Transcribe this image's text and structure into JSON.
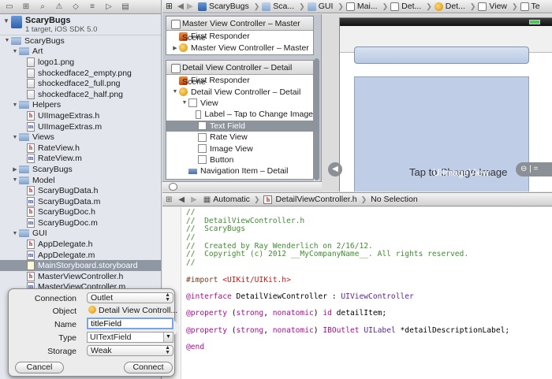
{
  "navigator": {
    "project": {
      "name": "ScaryBugs",
      "subtitle": "1 target, iOS SDK 5.0"
    },
    "tree": [
      {
        "label": "ScaryBugs",
        "kind": "folder",
        "level": 1,
        "open": true
      },
      {
        "label": "Art",
        "kind": "folder",
        "level": 2,
        "open": true
      },
      {
        "label": "logo1.png",
        "kind": "img",
        "level": 3
      },
      {
        "label": "shockedface2_empty.png",
        "kind": "img",
        "level": 3
      },
      {
        "label": "shockedface2_full.png",
        "kind": "img",
        "level": 3
      },
      {
        "label": "shockedface2_half.png",
        "kind": "img",
        "level": 3
      },
      {
        "label": "Helpers",
        "kind": "folder",
        "level": 2,
        "open": true
      },
      {
        "label": "UIImageExtras.h",
        "kind": "h",
        "level": 3
      },
      {
        "label": "UIImageExtras.m",
        "kind": "m",
        "level": 3
      },
      {
        "label": "Views",
        "kind": "folder",
        "level": 2,
        "open": true
      },
      {
        "label": "RateView.h",
        "kind": "h",
        "level": 3
      },
      {
        "label": "RateView.m",
        "kind": "m",
        "level": 3
      },
      {
        "label": "ScaryBugs",
        "kind": "folder",
        "level": 2,
        "open": false
      },
      {
        "label": "Model",
        "kind": "folder",
        "level": 2,
        "open": true
      },
      {
        "label": "ScaryBugData.h",
        "kind": "h",
        "level": 3
      },
      {
        "label": "ScaryBugData.m",
        "kind": "m",
        "level": 3
      },
      {
        "label": "ScaryBugDoc.h",
        "kind": "h",
        "level": 3
      },
      {
        "label": "ScaryBugDoc.m",
        "kind": "m",
        "level": 3
      },
      {
        "label": "GUI",
        "kind": "folder",
        "level": 2,
        "open": true
      },
      {
        "label": "AppDelegate.h",
        "kind": "h",
        "level": 3
      },
      {
        "label": "AppDelegate.m",
        "kind": "m",
        "level": 3
      },
      {
        "label": "MainStoryboard.storyboard",
        "kind": "sb",
        "level": 3,
        "selected": true
      },
      {
        "label": "MasterViewController.h",
        "kind": "h",
        "level": 3
      },
      {
        "label": "MasterViewController.m",
        "kind": "m",
        "level": 3
      }
    ]
  },
  "jumpbar": {
    "items": [
      {
        "label": "ScaryBugs",
        "icon": "proj"
      },
      {
        "label": "Sca...",
        "icon": "fold"
      },
      {
        "label": "GUI",
        "icon": "fold"
      },
      {
        "label": "Mai...",
        "icon": "file"
      },
      {
        "label": "Det...",
        "icon": "file"
      },
      {
        "label": "Det...",
        "icon": "obj"
      },
      {
        "label": "View",
        "icon": "file"
      },
      {
        "label": "Te",
        "icon": "file"
      }
    ]
  },
  "outline": {
    "master_scene": {
      "title": "Master View Controller – Master Scene",
      "rows": [
        {
          "label": "First Responder",
          "icon": "fr",
          "level": 1
        },
        {
          "label": "Master View Controller – Master",
          "icon": "vc",
          "level": 1,
          "disclosure": "closed"
        }
      ]
    },
    "detail_scene": {
      "title": "Detail View Controller – Detail Scene",
      "rows": [
        {
          "label": "First Responder",
          "icon": "fr",
          "level": 1
        },
        {
          "label": "Detail View Controller – Detail",
          "icon": "vc",
          "level": 1,
          "disclosure": "open"
        },
        {
          "label": "View",
          "icon": "view",
          "level": 2,
          "disclosure": "open"
        },
        {
          "label": "Label – Tap to Change Image",
          "icon": "view",
          "level": 3
        },
        {
          "label": "Text Field",
          "icon": "view",
          "level": 3,
          "selected": true
        },
        {
          "label": "Rate View",
          "icon": "view",
          "level": 3
        },
        {
          "label": "Image View",
          "icon": "view",
          "level": 3
        },
        {
          "label": "Button",
          "icon": "view",
          "level": 3
        },
        {
          "label": "Navigation Item – Detail",
          "icon": "nav-item",
          "level": 2
        }
      ]
    }
  },
  "canvas": {
    "label_text": "Tap to Change Image",
    "label_overlay": "UIImageView"
  },
  "editor_jump": {
    "scheme": "Automatic",
    "file": "DetailViewController.h",
    "selection": "No Selection"
  },
  "code": [
    {
      "text": "//",
      "class": "c-comment"
    },
    {
      "text": "//  DetailViewController.h",
      "class": "c-comment"
    },
    {
      "text": "//  ScaryBugs",
      "class": "c-comment"
    },
    {
      "text": "//",
      "class": "c-comment"
    },
    {
      "text": "//  Created by Ray Wenderlich on 2/16/12.",
      "class": "c-comment"
    },
    {
      "text": "//  Copyright (c) 2012 __MyCompanyName__. All rights reserved.",
      "class": "c-comment"
    },
    {
      "text": "//",
      "class": "c-comment"
    },
    {
      "text": "",
      "class": ""
    },
    {
      "parts": [
        {
          "text": "#import ",
          "class": "c-pre"
        },
        {
          "text": "<UIKit/UIKit.h>",
          "class": "c-str"
        }
      ]
    },
    {
      "text": "",
      "class": ""
    },
    {
      "parts": [
        {
          "text": "@interface",
          "class": "c-kw"
        },
        {
          "text": " DetailViewController : ",
          "class": ""
        },
        {
          "text": "UIViewController",
          "class": "c-type"
        }
      ]
    },
    {
      "text": "",
      "class": ""
    },
    {
      "parts": [
        {
          "text": "@property",
          "class": "c-kw"
        },
        {
          "text": " (",
          "class": ""
        },
        {
          "text": "strong",
          "class": "c-kw"
        },
        {
          "text": ", ",
          "class": ""
        },
        {
          "text": "nonatomic",
          "class": "c-kw"
        },
        {
          "text": ") ",
          "class": ""
        },
        {
          "text": "id",
          "class": "c-kw"
        },
        {
          "text": " detailItem;",
          "class": ""
        }
      ]
    },
    {
      "text": "",
      "class": ""
    },
    {
      "parts": [
        {
          "text": "@property",
          "class": "c-kw"
        },
        {
          "text": " (",
          "class": ""
        },
        {
          "text": "strong",
          "class": "c-kw"
        },
        {
          "text": ", ",
          "class": ""
        },
        {
          "text": "nonatomic",
          "class": "c-kw"
        },
        {
          "text": ") ",
          "class": ""
        },
        {
          "text": "IBOutlet",
          "class": "c-kw"
        },
        {
          "text": " ",
          "class": ""
        },
        {
          "text": "UILabel",
          "class": "c-type"
        },
        {
          "text": " *detailDescriptionLabel;",
          "class": ""
        }
      ]
    },
    {
      "text": "",
      "class": ""
    },
    {
      "text": "@end",
      "class": "c-kw"
    }
  ],
  "popover": {
    "connection_label": "Connection",
    "connection_value": "Outlet",
    "object_label": "Object",
    "object_value": "Detail View Controll...",
    "name_label": "Name",
    "name_value": "titleField",
    "type_label": "Type",
    "type_value": "UITextField",
    "storage_label": "Storage",
    "storage_value": "Weak",
    "cancel_label": "Cancel",
    "connect_label": "Connect"
  }
}
